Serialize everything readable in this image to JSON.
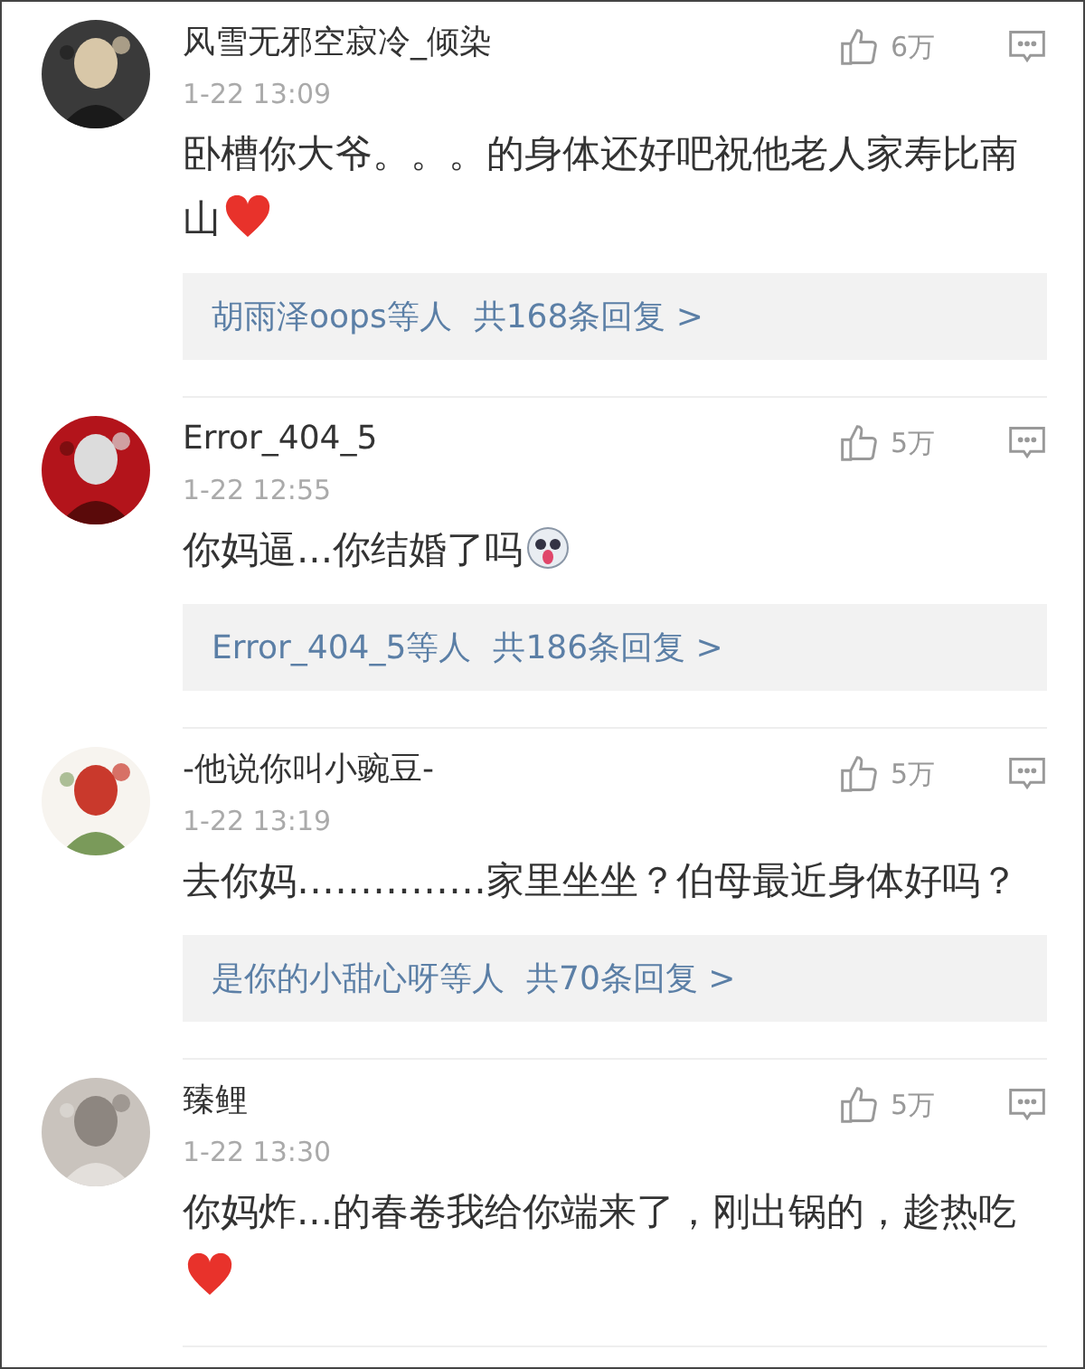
{
  "comments": [
    {
      "username": "风雪无邪空寂冷_倾染",
      "time": "1-22 13:09",
      "likes": "6万",
      "text": "卧槽你大爷。。。的身体还好吧祝他老人家寿比南山",
      "heart_emoji": true,
      "replies": {
        "users": "胡雨泽oops等人",
        "count": "共168条回复 >"
      }
    },
    {
      "username": "Error_404_5",
      "time": "1-22 12:55",
      "likes": "5万",
      "text": "你妈逼...你结婚了吗",
      "face_emoji": true,
      "replies": {
        "users": "Error_404_5等人",
        "count": "共186条回复 >"
      }
    },
    {
      "username": "-他说你叫小豌豆-",
      "time": "1-22 13:19",
      "likes": "5万",
      "text": "去你妈……………家里坐坐？伯母最近身体好吗？",
      "replies": {
        "users": "是你的小甜心呀等人",
        "count": "共70条回复 >"
      }
    },
    {
      "username": "臻鲤",
      "time": "1-22 13:30",
      "likes": "5万",
      "text": "你妈炸...的春卷我给你端来了，刚出锅的，趁热吃",
      "heart_emoji": true
    }
  ]
}
